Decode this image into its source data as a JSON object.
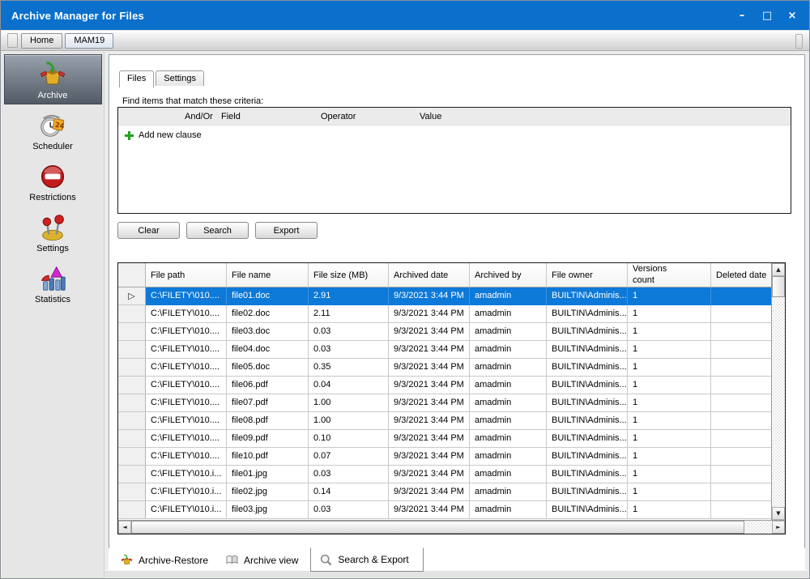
{
  "window": {
    "title": "Archive Manager for Files",
    "controls": [
      {
        "name": "minimize-icon",
        "glyph": "–"
      },
      {
        "name": "maximize-icon",
        "glyph": "□"
      },
      {
        "name": "close-icon",
        "glyph": "×"
      }
    ]
  },
  "toolbar": {
    "items": [
      {
        "label": "Home",
        "selected": false
      },
      {
        "label": "MAM19",
        "selected": true
      }
    ]
  },
  "sidebar": {
    "items": [
      {
        "label": "Archive",
        "icon": "archive-box-icon",
        "selected": true
      },
      {
        "label": "Scheduler",
        "icon": "scheduler-clock-icon",
        "selected": false
      },
      {
        "label": "Restrictions",
        "icon": "restrictions-no-entry-icon",
        "selected": false
      },
      {
        "label": "Settings",
        "icon": "settings-levers-icon",
        "selected": false
      },
      {
        "label": "Statistics",
        "icon": "statistics-chart-icon",
        "selected": false
      }
    ]
  },
  "page": {
    "tabs": [
      {
        "label": "Files",
        "active": true
      },
      {
        "label": "Settings",
        "active": false
      }
    ],
    "criteria": {
      "label": "Find items that match these criteria:",
      "columns": [
        "And/Or",
        "Field",
        "Operator",
        "Value"
      ],
      "add_clause_label": "Add new clause"
    },
    "action_buttons": [
      {
        "label": "Clear"
      },
      {
        "label": "Search"
      },
      {
        "label": "Export"
      }
    ],
    "table": {
      "columns": [
        "File path",
        "File name",
        "File size (MB)",
        "Archived date",
        "Archived by",
        "File owner",
        "Versions count",
        "Deleted date"
      ],
      "selected_row_index": 0,
      "rows": [
        [
          "C:\\FILETY\\010....",
          "file01.doc",
          "2.91",
          "9/3/2021 3:44 PM",
          "amadmin",
          "BUILTIN\\Adminis...",
          "1",
          ""
        ],
        [
          "C:\\FILETY\\010....",
          "file02.doc",
          "2.11",
          "9/3/2021 3:44 PM",
          "amadmin",
          "BUILTIN\\Adminis...",
          "1",
          ""
        ],
        [
          "C:\\FILETY\\010....",
          "file03.doc",
          "0.03",
          "9/3/2021 3:44 PM",
          "amadmin",
          "BUILTIN\\Adminis...",
          "1",
          ""
        ],
        [
          "C:\\FILETY\\010....",
          "file04.doc",
          "0.03",
          "9/3/2021 3:44 PM",
          "amadmin",
          "BUILTIN\\Adminis...",
          "1",
          ""
        ],
        [
          "C:\\FILETY\\010....",
          "file05.doc",
          "0.35",
          "9/3/2021 3:44 PM",
          "amadmin",
          "BUILTIN\\Adminis...",
          "1",
          ""
        ],
        [
          "C:\\FILETY\\010....",
          "file06.pdf",
          "0.04",
          "9/3/2021 3:44 PM",
          "amadmin",
          "BUILTIN\\Adminis...",
          "1",
          ""
        ],
        [
          "C:\\FILETY\\010....",
          "file07.pdf",
          "1.00",
          "9/3/2021 3:44 PM",
          "amadmin",
          "BUILTIN\\Adminis...",
          "1",
          ""
        ],
        [
          "C:\\FILETY\\010....",
          "file08.pdf",
          "1.00",
          "9/3/2021 3:44 PM",
          "amadmin",
          "BUILTIN\\Adminis...",
          "1",
          ""
        ],
        [
          "C:\\FILETY\\010....",
          "file09.pdf",
          "0.10",
          "9/3/2021 3:44 PM",
          "amadmin",
          "BUILTIN\\Adminis...",
          "1",
          ""
        ],
        [
          "C:\\FILETY\\010....",
          "file10.pdf",
          "0.07",
          "9/3/2021 3:44 PM",
          "amadmin",
          "BUILTIN\\Adminis...",
          "1",
          ""
        ],
        [
          "C:\\FILETY\\010.i...",
          "file01.jpg",
          "0.03",
          "9/3/2021 3:44 PM",
          "amadmin",
          "BUILTIN\\Adminis...",
          "1",
          ""
        ],
        [
          "C:\\FILETY\\010.i...",
          "file02.jpg",
          "0.14",
          "9/3/2021 3:44 PM",
          "amadmin",
          "BUILTIN\\Adminis...",
          "1",
          ""
        ],
        [
          "C:\\FILETY\\010.i...",
          "file03.jpg",
          "0.03",
          "9/3/2021 3:44 PM",
          "amadmin",
          "BUILTIN\\Adminis...",
          "1",
          ""
        ]
      ]
    },
    "bottom_tabs": [
      {
        "label": "Archive-Restore",
        "icon": "archive-box-icon",
        "active": false
      },
      {
        "label": "Archive view",
        "icon": "book-icon",
        "active": false
      },
      {
        "label": "Search & Export",
        "icon": "magnifier-icon",
        "active": true
      }
    ]
  },
  "colors": {
    "titlebar": "#0b70cc",
    "selection": "#0d79d8",
    "add-clause-green": "#1ea51e",
    "sidebar-selected-top": "#99a1ac",
    "sidebar-selected-bottom": "#525a66"
  }
}
